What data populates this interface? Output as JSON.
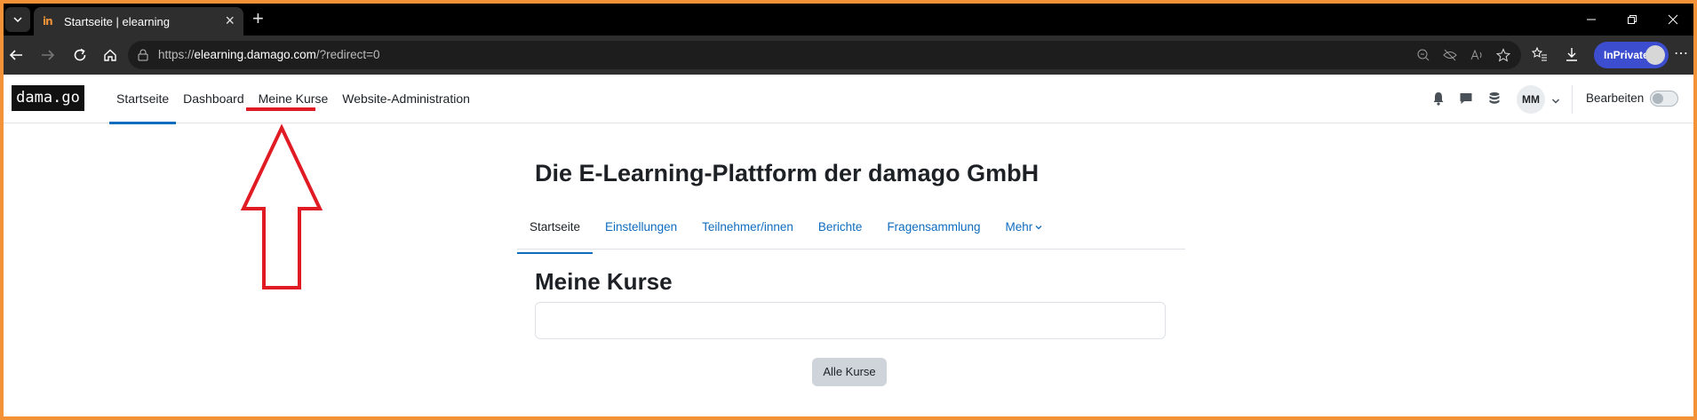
{
  "browser": {
    "tab_title": "Startseite | elearning",
    "tab_favicon_text": "in",
    "url_prefix": "https://",
    "url_host": "elearning.damago.com",
    "url_path": "/?redirect=0",
    "inprivate_label": "InPrivate",
    "colors": {
      "frame_border": "#f39237",
      "inprivate": "#3c4ecf",
      "tab_bar": "#000000",
      "address_bar": "#2e2e2e"
    }
  },
  "navbar": {
    "logo_text": "dama.go",
    "items": [
      {
        "label": "Startseite",
        "active": true
      },
      {
        "label": "Dashboard",
        "active": false
      },
      {
        "label": "Meine Kurse",
        "active": false
      },
      {
        "label": "Website-Administration",
        "active": false
      }
    ],
    "user_initials": "MM",
    "edit_mode_label": "Bearbeiten",
    "edit_mode_on": false,
    "icons": [
      "bell-icon",
      "chat-icon",
      "database-icon"
    ]
  },
  "page": {
    "title": "Die E-Learning-Plattform der damago GmbH",
    "tabs": [
      {
        "label": "Startseite",
        "active": true
      },
      {
        "label": "Einstellungen",
        "active": false
      },
      {
        "label": "Teilnehmer/innen",
        "active": false
      },
      {
        "label": "Berichte",
        "active": false
      },
      {
        "label": "Fragensammlung",
        "active": false
      },
      {
        "label": "Mehr",
        "active": false
      }
    ],
    "section_title": "Meine Kurse",
    "all_courses_button": "Alle Kurse"
  },
  "annotation": {
    "color": "#e01b24",
    "highlighted_item": "Meine Kurse"
  }
}
